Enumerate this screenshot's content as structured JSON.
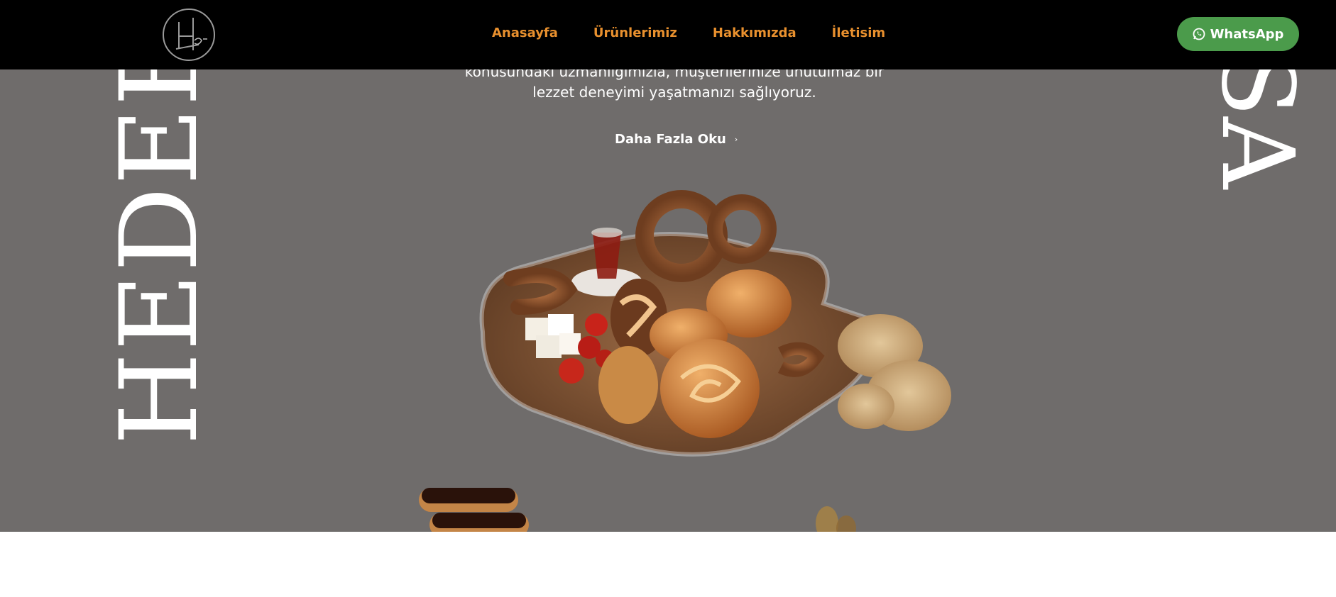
{
  "header": {
    "logo_alt": "Hedef",
    "nav": [
      {
        "label": "Anasayfa"
      },
      {
        "label": "Ürünlerimiz"
      },
      {
        "label": "Hakkımızda"
      },
      {
        "label": "İletisim"
      }
    ],
    "whatsapp_label": "WhatsApp"
  },
  "hero": {
    "left_word": "HEDEF",
    "right_word": "ASA",
    "intro_line1": "konusundaki uzmanlığımızla, müşterilerinize unutulmaz bir",
    "intro_line2": "lezzet deneyimi yaşatmanızı sağlıyoruz.",
    "more_label": "Daha Fazla Oku",
    "more_chevron": "›"
  },
  "colors": {
    "header_bg": "#000000",
    "nav_text": "#e8902e",
    "whatsapp_bg": "#4b9b4b",
    "hero_bg": "#6f6c6b",
    "text": "#ffffff"
  },
  "icons": {
    "logo": "hedef-logo-icon",
    "whatsapp": "whatsapp-icon",
    "chevron": "chevron-right-icon"
  }
}
